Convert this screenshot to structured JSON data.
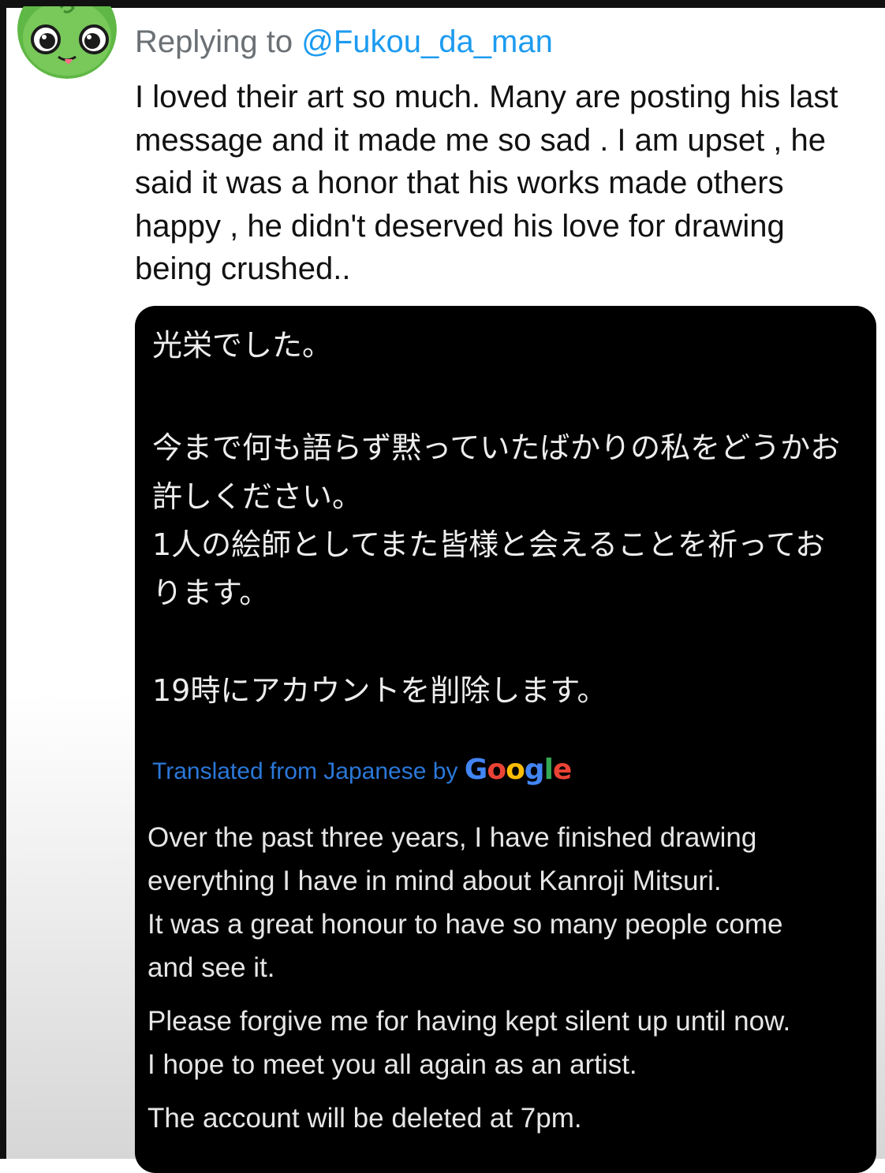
{
  "reply": {
    "prefix": "Replying to ",
    "handle": "@Fukou_da_man"
  },
  "tweet": {
    "lines": [
      "I loved their art so much. Many are posting his last",
      "message and it made me so sad . I am upset , he",
      "said it was a honor that his works made others",
      "happy , he didn't deserved his love for drawing",
      "being crushed.."
    ]
  },
  "image": {
    "japanese_lines": [
      "光栄でした。",
      "今まで何も語らず黙っていたばかりの私をどうかお",
      "許しください。",
      "1人の絵師としてまた皆様と会えることを祈ってお",
      "ります。",
      "19時にアカウントを削除します。"
    ],
    "translated_label": "Translated from Japanese by",
    "google_letters": [
      "G",
      "o",
      "o",
      "g",
      "l",
      "e"
    ],
    "english_lines": [
      "Over the past three years, I have finished drawing",
      "everything I have in mind about Kanroji Mitsuri.",
      "It was a great honour to have so many people come",
      "and see it.",
      "Please forgive me for having kept silent up until now.",
      "I hope to meet you all again as an artist.",
      "The account will be deleted at 7pm."
    ]
  },
  "colors": {
    "handle": "#1d9bf0",
    "google": [
      "#4285f4",
      "#ea4335",
      "#fbbc05",
      "#4285f4",
      "#34a853",
      "#ea4335"
    ]
  },
  "icons": {
    "avatar": "green-frog-avatar-icon"
  }
}
